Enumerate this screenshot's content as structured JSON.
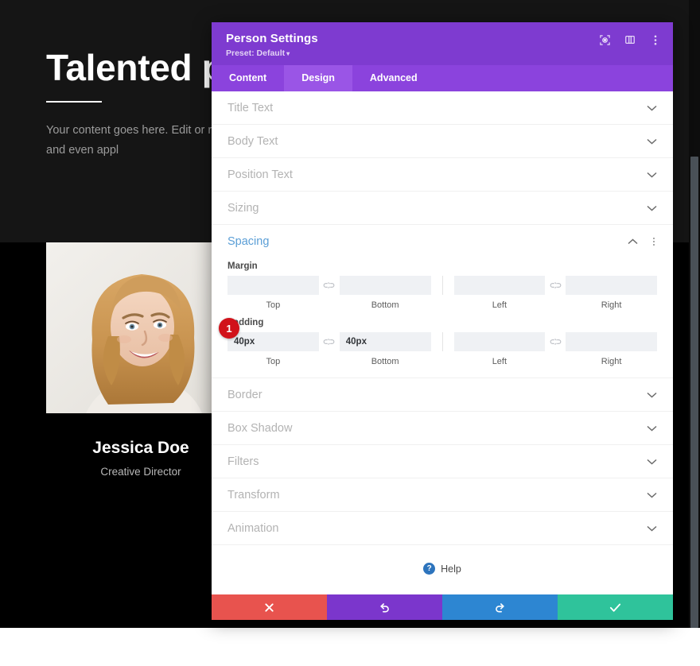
{
  "background_page": {
    "heading": "Talented peo",
    "paragraph": "Your content goes here. Edit or remove module Design settings and even appl",
    "person": {
      "name": "Jessica Doe",
      "role": "Creative Director",
      "photo": "portrait-smiling-blonde-woman"
    }
  },
  "settings_modal": {
    "header": {
      "title": "Person Settings",
      "preset_label": "Preset: Default",
      "preset_caret": "▾",
      "icons": [
        {
          "name": "target-fullscreen-icon"
        },
        {
          "name": "layout-panel-icon"
        },
        {
          "name": "kebab-menu-icon"
        }
      ]
    },
    "tabs": [
      {
        "label": "Content",
        "active": false
      },
      {
        "label": "Design",
        "active": true
      },
      {
        "label": "Advanced",
        "active": false
      }
    ],
    "collapsed_sections_top": [
      {
        "label": "Title Text"
      },
      {
        "label": "Body Text"
      },
      {
        "label": "Position Text"
      },
      {
        "label": "Sizing"
      }
    ],
    "spacing_group": {
      "title": "Spacing",
      "collapse_icon": "chevron-up-icon",
      "menu_icon": "kebab-menu-icon",
      "margin": {
        "legend": "Margin",
        "fields": [
          {
            "label": "Top",
            "value": "",
            "placeholder": ""
          },
          {
            "label": "Bottom",
            "value": "",
            "placeholder": ""
          },
          {
            "label": "Left",
            "value": "",
            "placeholder": ""
          },
          {
            "label": "Right",
            "value": "",
            "placeholder": ""
          }
        ],
        "link_icon": "broken-link-icon"
      },
      "padding": {
        "legend": "Padding",
        "badge": "1",
        "fields": [
          {
            "label": "Top",
            "value": "40px",
            "placeholder": ""
          },
          {
            "label": "Bottom",
            "value": "40px",
            "placeholder": ""
          },
          {
            "label": "Left",
            "value": "",
            "placeholder": ""
          },
          {
            "label": "Right",
            "value": "",
            "placeholder": ""
          }
        ],
        "link_icon": "broken-link-icon"
      }
    },
    "collapsed_sections_bottom": [
      {
        "label": "Border"
      },
      {
        "label": "Box Shadow"
      },
      {
        "label": "Filters"
      },
      {
        "label": "Transform"
      },
      {
        "label": "Animation"
      }
    ],
    "help": {
      "label": "Help",
      "icon_glyph": "?"
    },
    "footer_buttons": [
      {
        "name": "cancel-button",
        "icon": "close-x-icon",
        "color": "#e8534e"
      },
      {
        "name": "undo-button",
        "icon": "undo-arrow-icon",
        "color": "#7b36cc"
      },
      {
        "name": "redo-button",
        "icon": "redo-arrow-icon",
        "color": "#2d86d2"
      },
      {
        "name": "save-button",
        "icon": "checkmark-icon",
        "color": "#2fc39b"
      }
    ]
  },
  "colors": {
    "header_purple": "#7e3bd0",
    "tabbar_purple": "#8b43dd",
    "tab_active_purple": "#9a55e6",
    "group_title_blue": "#5a9ed6",
    "badge_red": "#d1121a",
    "page_black": "#000000"
  }
}
